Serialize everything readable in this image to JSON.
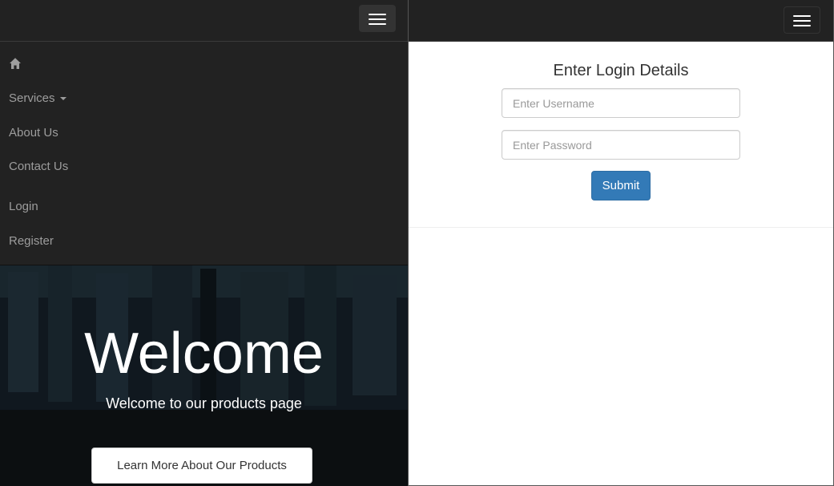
{
  "left": {
    "menu": {
      "home_icon": "home-icon",
      "services_label": "Services",
      "about_label": "About Us",
      "contact_label": "Contact Us",
      "login_label": "Login",
      "register_label": "Register"
    },
    "hero": {
      "title": "Welcome",
      "subtitle": "Welcome to our products page",
      "button_label": "Learn More About Our Products"
    }
  },
  "right": {
    "login": {
      "title": "Enter Login Details",
      "username_placeholder": "Enter Username",
      "username_value": "",
      "password_placeholder": "Enter Password",
      "password_value": "",
      "submit_label": "Submit"
    }
  },
  "colors": {
    "navbar": "#222222",
    "menu_text": "#9d9d9d",
    "primary_button": "#337ab7"
  }
}
